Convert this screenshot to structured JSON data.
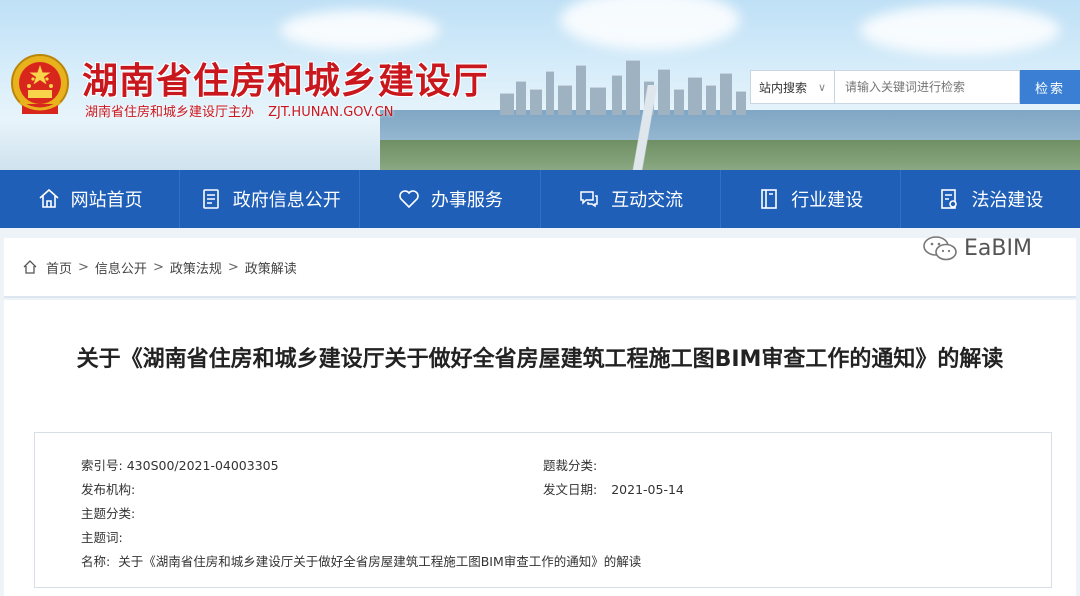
{
  "header": {
    "title": "湖南省住房和城乡建设厅",
    "sponsor": "湖南省住房和城乡建设厅主办",
    "domain": "ZJT.HUNAN.GOV.CN"
  },
  "search": {
    "scope": "站内搜索",
    "placeholder": "请输入关键词进行检索",
    "button": "检索"
  },
  "nav": {
    "items": [
      {
        "label": "网站首页",
        "icon": "home-icon"
      },
      {
        "label": "政府信息公开",
        "icon": "document-icon"
      },
      {
        "label": "办事服务",
        "icon": "heart-icon"
      },
      {
        "label": "互动交流",
        "icon": "chat-icon"
      },
      {
        "label": "行业建设",
        "icon": "book-icon"
      },
      {
        "label": "法治建设",
        "icon": "law-icon"
      }
    ]
  },
  "breadcrumb": {
    "items": [
      "首页",
      "信息公开",
      "政策法规",
      "政策解读"
    ],
    "separator": ">"
  },
  "article": {
    "title": "关于《湖南省住房和城乡建设厅关于做好全省房屋建筑工程施工图BIM审查工作的通知》的解读",
    "meta": {
      "index_label": "索引号:",
      "index_value": "430S00/2021-04003305",
      "subject_class_label": "题裁分类:",
      "subject_class_value": "",
      "publisher_label": "发布机构:",
      "publisher_value": "",
      "date_label": "发文日期:",
      "date_value": "2021-05-14",
      "topic_class_label": "主题分类:",
      "topic_class_value": "",
      "keywords_label": "主题词:",
      "keywords_value": "",
      "name_label": "名称:",
      "name_value": "关于《湖南省住房和城乡建设厅关于做好全省房屋建筑工程施工图BIM审查工作的通知》的解读"
    }
  },
  "watermark": {
    "text": "EaBIM"
  },
  "colors": {
    "brand_red": "#c9171e",
    "nav_blue": "#1f5fb8",
    "search_blue": "#3a7fd4"
  }
}
